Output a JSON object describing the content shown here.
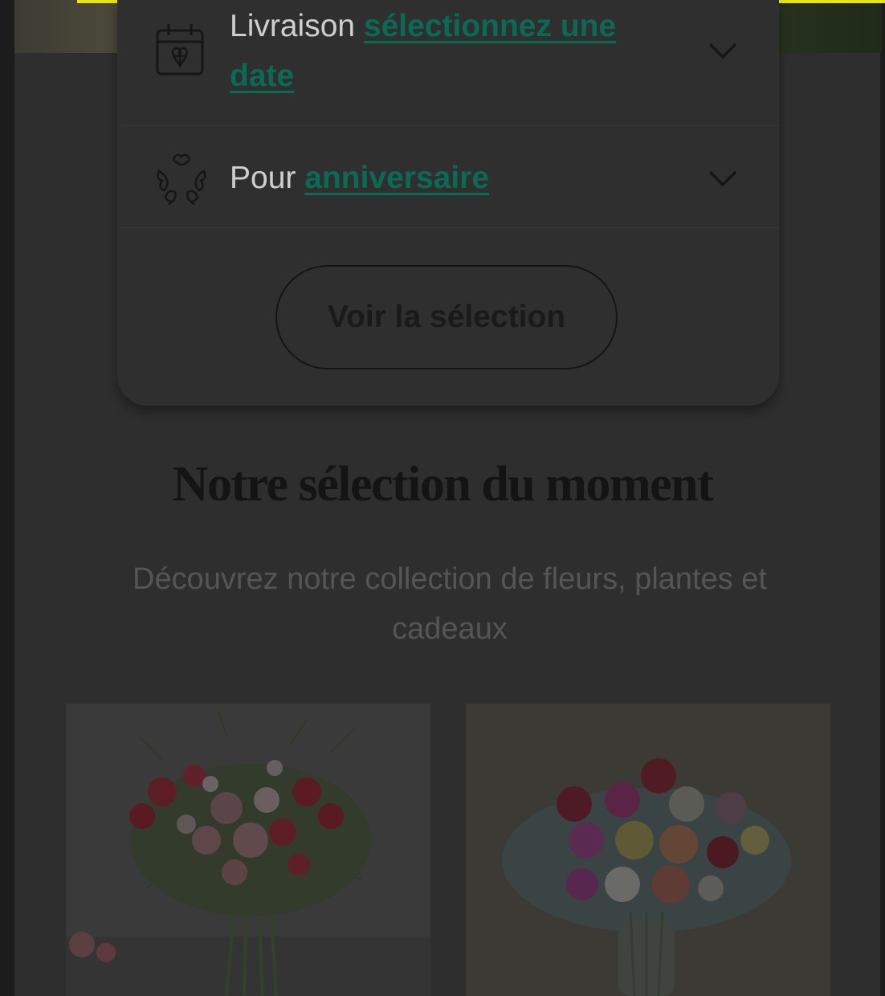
{
  "finder": {
    "delivery": {
      "lead": "Livraison",
      "link": "sélectionnez une date",
      "icon": "calendar-gift-icon"
    },
    "occasion": {
      "lead": "Pour",
      "link": "anniversaire",
      "icon": "flower-wreath-icon"
    },
    "cta_label": "Voir la sélection"
  },
  "section": {
    "title": "Notre sélection du moment",
    "subtitle": "Découvrez notre collection de fleurs, plantes et cadeaux"
  },
  "colors": {
    "link": "#0b6a55",
    "accent_bar": "#e8e21a",
    "overlay_bg": "#2e2e2e"
  }
}
